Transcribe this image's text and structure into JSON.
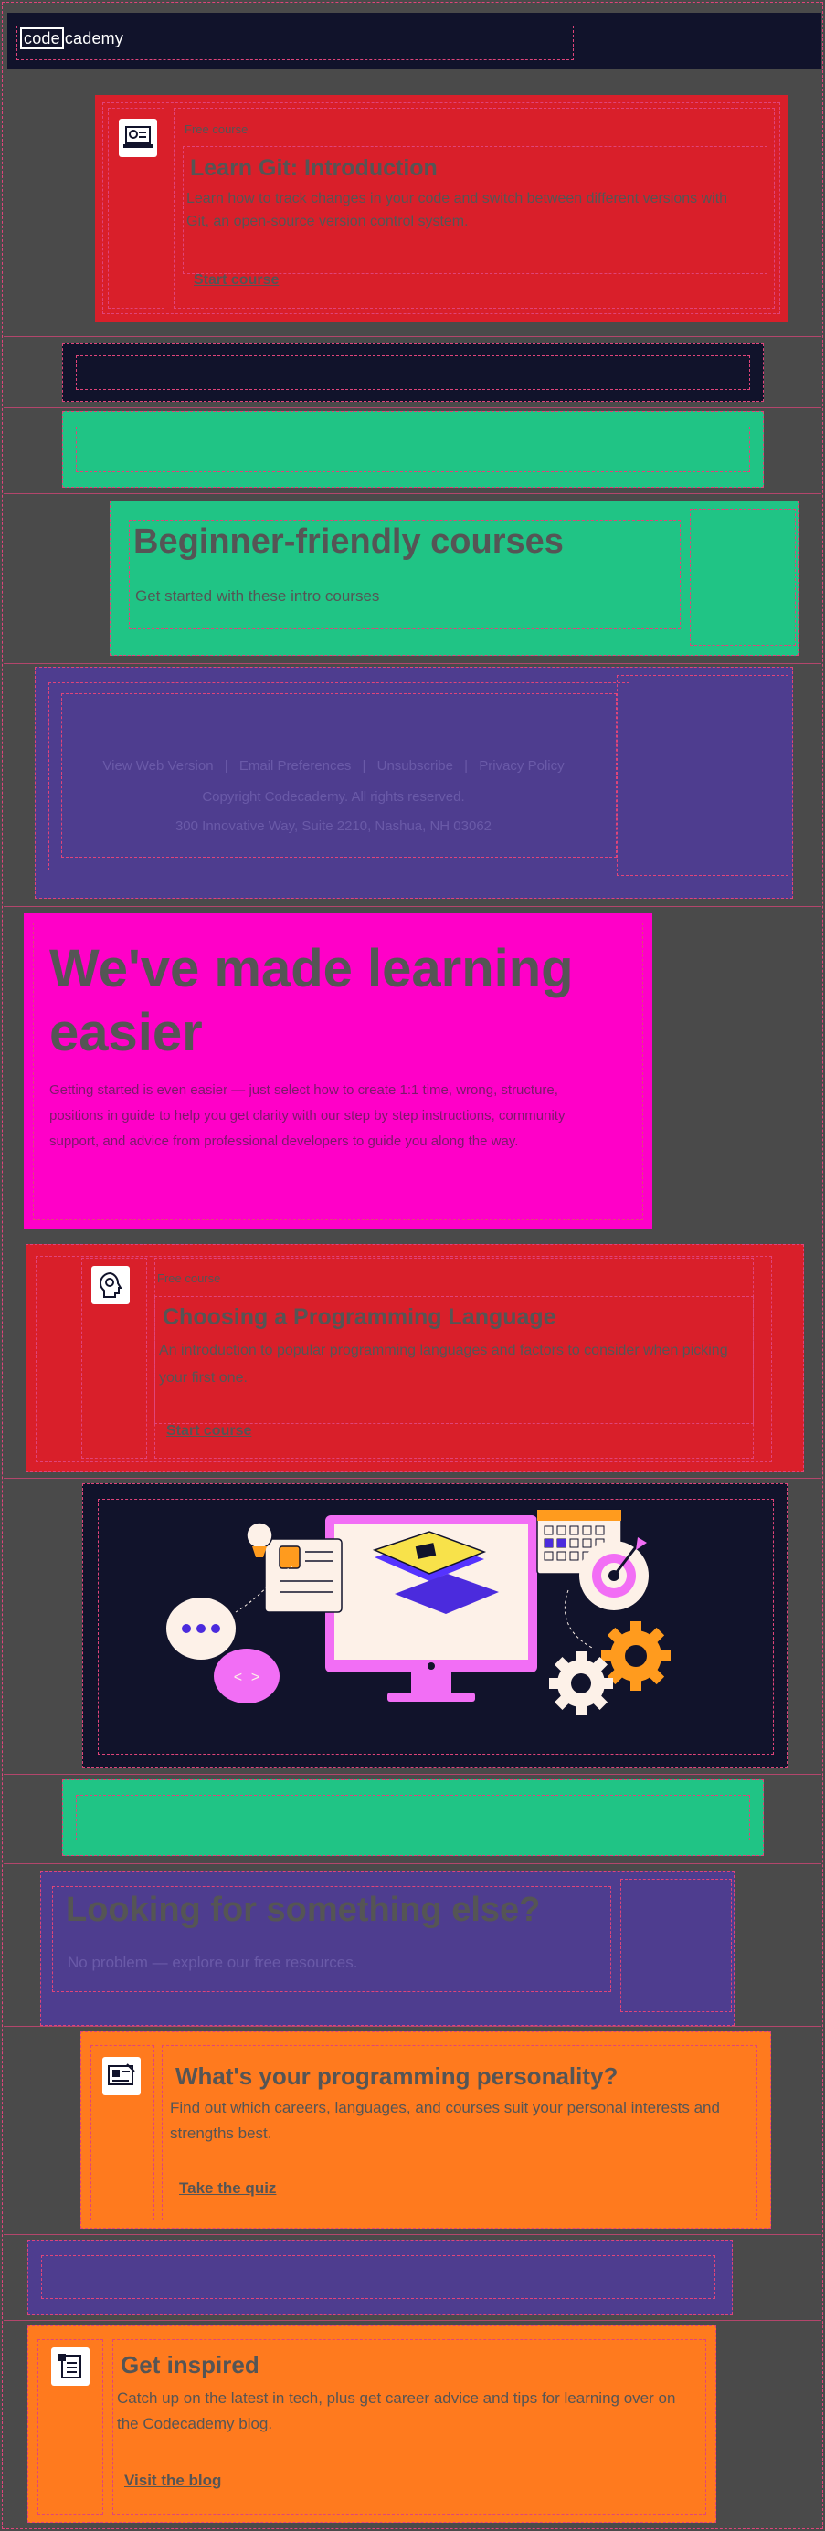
{
  "header": {
    "logo_code": "code",
    "logo_rest": "cademy"
  },
  "course1": {
    "eyebrow": "Free course",
    "title": "Learn Git: Introduction",
    "description": "Learn how to track changes in your code and switch between different versions with Git, an open-source version control system.",
    "cta": "Start course",
    "icon": "laptop-gear-icon"
  },
  "beginner": {
    "title": "Beginner-friendly courses",
    "subtitle": "Get started with these intro courses"
  },
  "footer": {
    "links": [
      "View Web Version",
      "Email Preferences",
      "Unsubscribe",
      "Privacy Policy"
    ],
    "copyright": "Copyright Codecademy. All rights reserved.",
    "address": "300 Innovative Way, Suite 2210, Nashua, NH 03062"
  },
  "hero": {
    "title": "We've made learning easier",
    "body": "Getting started is even easier — just select how to create 1:1 time, wrong, structure, positions in guide to help you get clarity with our step by step instructions, community support, and advice from professional developers to guide you along the way."
  },
  "course2": {
    "eyebrow": "Free course",
    "title": "Choosing a Programming Language",
    "description": "An introduction to popular programming languages and factors to consider when picking your first one.",
    "cta": "Start course",
    "icon": "head-gear-icon"
  },
  "looking": {
    "title": "Looking for something else?",
    "subtitle": "No problem — explore our free resources."
  },
  "personality": {
    "title": "What's your programming personality?",
    "description": "Find out which careers, languages, and courses suit your personal interests and strengths best.",
    "cta": "Take the quiz",
    "icon": "quiz-icon"
  },
  "inspired": {
    "title": "Get inspired",
    "description": "Catch up on the latest in tech, plus get career advice and tips for learning over on the Codecademy blog.",
    "cta": "Visit the blog",
    "icon": "blog-icon"
  },
  "colors": {
    "navy": "#11132b",
    "red": "#d91f2a",
    "green": "#20c485",
    "purple": "#4e3d8f",
    "magenta": "#ff00c8",
    "orange": "#ff7a1e",
    "background": "#4a4a4a"
  }
}
